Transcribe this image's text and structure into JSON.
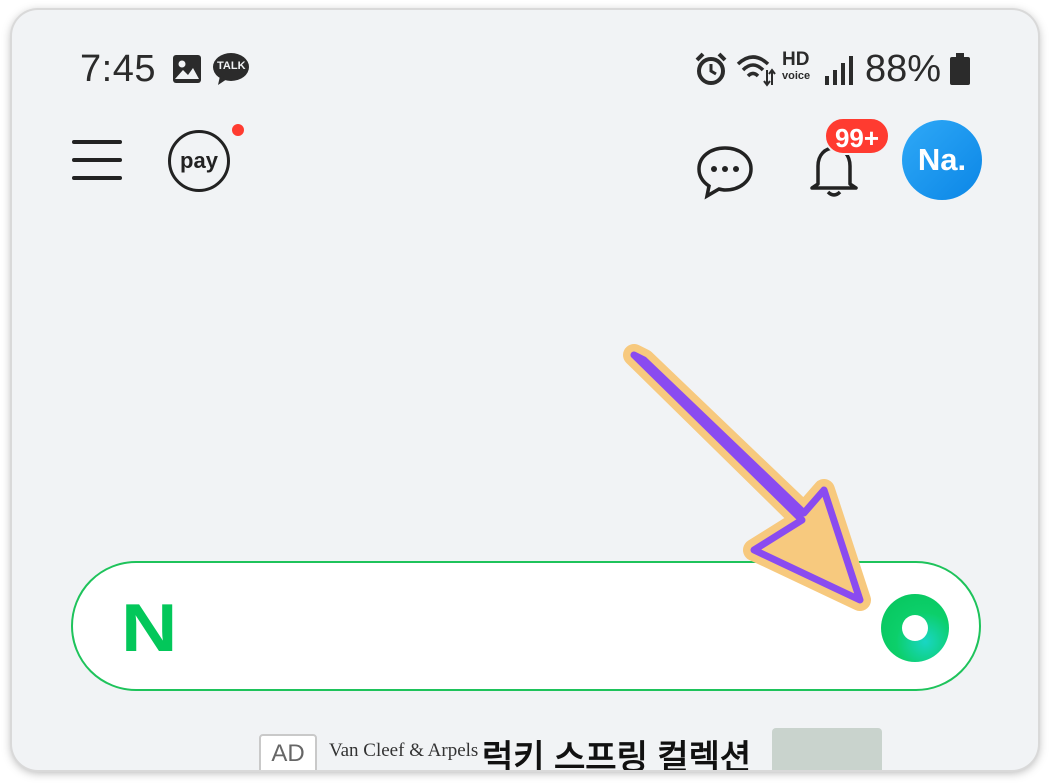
{
  "status_bar": {
    "time": "7:45",
    "left_icons": [
      "gallery-icon",
      "kakaotalk-icon"
    ],
    "talk_label": "TALK",
    "right_icons": [
      "alarm-icon",
      "wifi-icon",
      "hd-voice-icon",
      "signal-icon",
      "battery-icon"
    ],
    "hd_label": "HD",
    "voice_label": "voice",
    "battery_percent": "88%"
  },
  "header": {
    "menu_icon": "hamburger-menu-icon",
    "pay_label": "pay",
    "pay_has_notification": true,
    "chat_icon": "chat-bubble-icon",
    "bell_icon": "bell-icon",
    "notification_badge": "99+",
    "avatar_text": "Na."
  },
  "search": {
    "logo_text": "N",
    "value": "",
    "placeholder": "",
    "search_button_icon": "green-search-circle-icon"
  },
  "ad": {
    "badge": "AD",
    "brand": "Van Cleef & Arpels",
    "title": "럭키 스프링 컬렉션"
  },
  "annotation": {
    "type": "arrow",
    "color": "#8a4bf0",
    "outline_color": "#f7c97e"
  },
  "colors": {
    "background": "#f1f3f5",
    "accent_green": "#03c75a",
    "badge_red": "#ff3b30",
    "avatar_blue": "#1597ee"
  }
}
